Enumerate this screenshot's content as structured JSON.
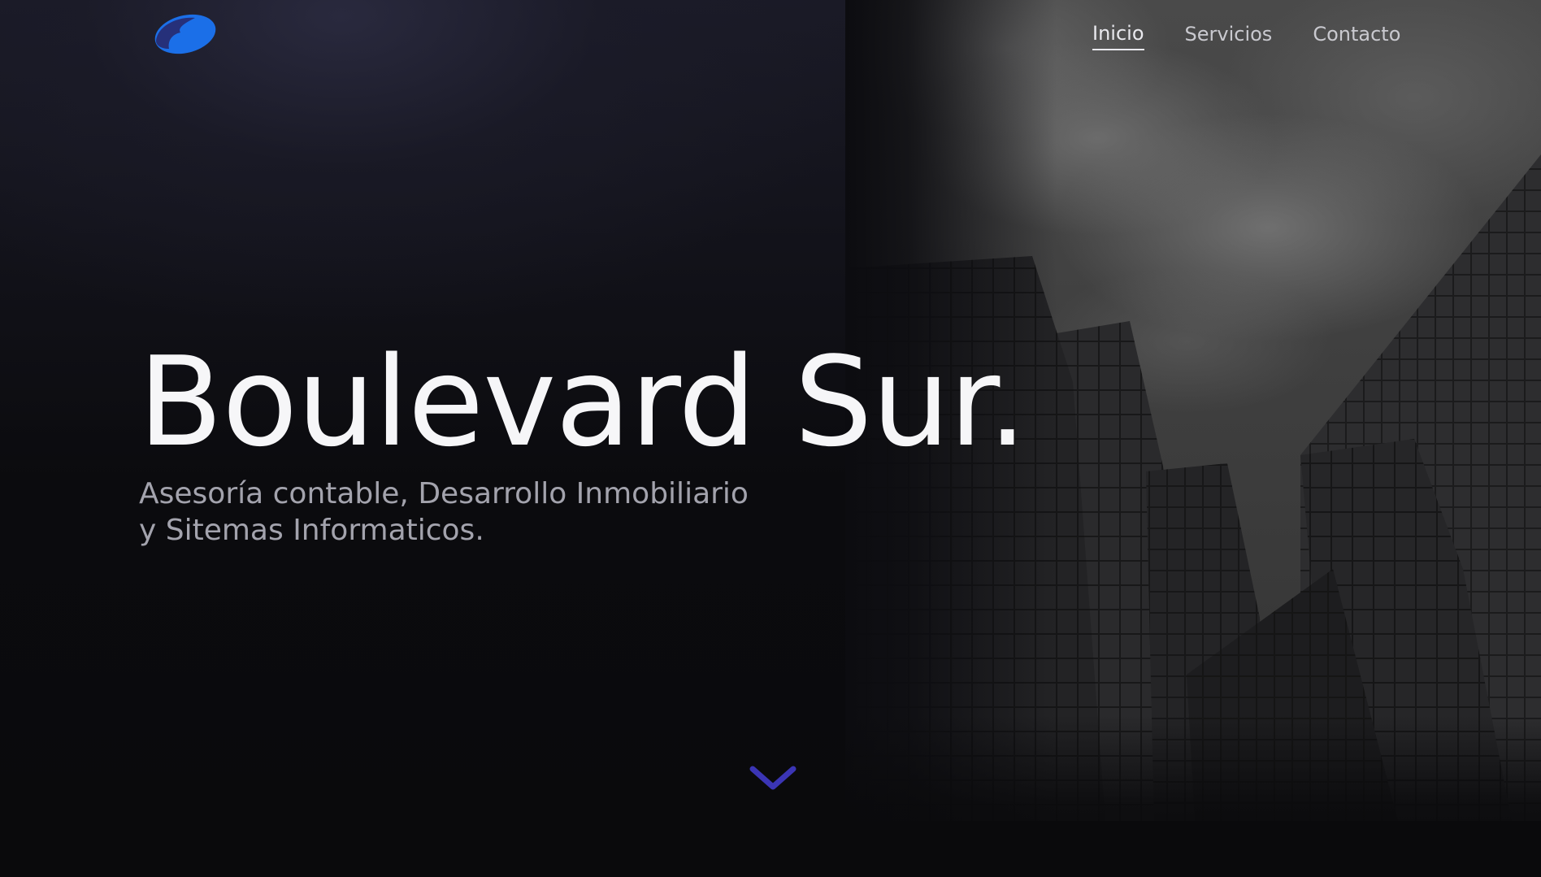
{
  "brand": {
    "logo_icon": "ellipse-swoosh-logo-icon",
    "colors": {
      "logo_primary": "#1b6fe8",
      "logo_secondary": "#26307a",
      "accent_arrow": "#3b35b5"
    }
  },
  "nav": {
    "items": [
      {
        "label": "Inicio",
        "active": true
      },
      {
        "label": "Servicios",
        "active": false
      },
      {
        "label": "Contacto",
        "active": false
      }
    ]
  },
  "hero": {
    "title": "Boulevard Sur.",
    "subtitle_line1": "Asesoría contable, Desarrollo Inmobiliario",
    "subtitle_line2": "y Sitemas Informaticos.",
    "background_image": "dark-skyscrapers-photo",
    "scroll_icon": "chevron-down-icon"
  }
}
